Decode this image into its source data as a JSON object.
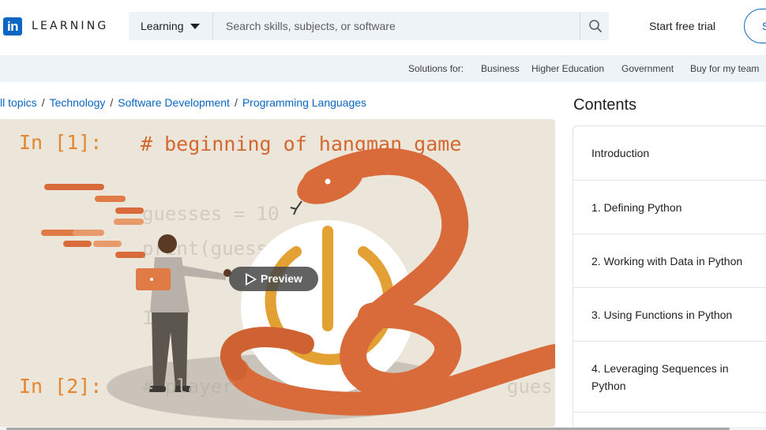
{
  "header": {
    "logo_mark": "in",
    "logo_text": "LEARNING",
    "search_scope": "Learning",
    "search_placeholder": "Search skills, subjects, or software",
    "start_trial": "Start free trial",
    "sign_in": "S"
  },
  "solutions": {
    "label": "Solutions for:",
    "items": [
      "Business",
      "Higher Education",
      "Government",
      "Buy for my team"
    ]
  },
  "breadcrumb": [
    "ll topics",
    "Technology",
    "Software Development",
    "Programming Languages"
  ],
  "hero": {
    "code_line1_prompt": "In [1]:",
    "code_line1_comment": "# beginning of hangman game",
    "code_line2": "guesses = 10",
    "code_line3": "print(guesses)",
    "code_line4": "10",
    "code_line5_prompt": "In [2]:",
    "code_line5_text": "# player",
    "code_line5_tail": "gues",
    "preview_label": "Preview",
    "colors": {
      "background": "#ebe5da",
      "snake": "#d96b3b",
      "accent_orange": "#e07b45",
      "gold": "#e3a133"
    }
  },
  "contents": {
    "title": "Contents",
    "items": [
      "Introduction",
      "1. Defining Python",
      "2. Working with Data in Python",
      "3. Using Functions in Python",
      "4. Leveraging Sequences in Python"
    ]
  },
  "colors": {
    "brand": "#0a66c2",
    "band": "#eef3f8"
  }
}
